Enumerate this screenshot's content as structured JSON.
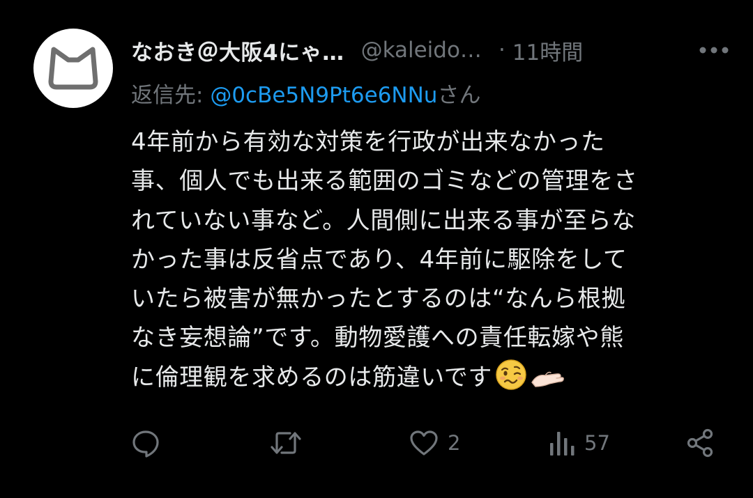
{
  "tweet": {
    "display_name": "なおき＠大阪4にゃ…",
    "handle": "@kaleido…",
    "separator": "·",
    "time": "11時間",
    "reply_prefix": "返信先: ",
    "reply_mention": "@0cBe5N9Pt6e6NNu",
    "reply_suffix": "さん",
    "text_lines": [
      "4年前から有効な対策を行政が出来なかった",
      "事、個人でも出来る範囲のゴミなどの管理をさ",
      "れていない事など。人間側に出来る事が至らな",
      "かった事は反省点であり、4年前に駆除をして",
      "いたら被害が無かったとするのは“なんら根拠",
      "なき妄想論”です。動物愛護への責任転嫁や熊",
      "に倫理観を求めるのは筋違いです"
    ],
    "emojis": [
      "woozy-face-emoji",
      "palm-up-hand-emoji"
    ]
  },
  "actions": {
    "reply_count": "",
    "retweet_count": "",
    "like_count": "2",
    "views_count": "57"
  },
  "icons": {
    "avatar": "cat-outline-icon",
    "more": "more-dots-icon",
    "reply": "reply-icon",
    "retweet": "retweet-icon",
    "like": "heart-icon",
    "views": "views-icon",
    "share": "share-icon"
  },
  "colors": {
    "background": "#000000",
    "text": "#e7e9ea",
    "muted": "#71767b",
    "link": "#1d9bf0"
  }
}
